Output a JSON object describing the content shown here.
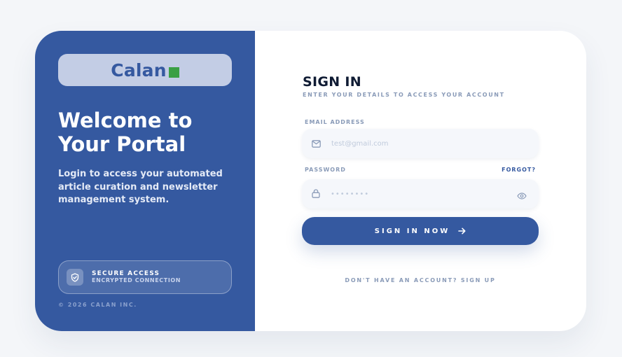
{
  "brand": {
    "name": "Calan",
    "accent_color": "#3aa045",
    "primary_color": "#3559a0"
  },
  "left_panel": {
    "welcome_line1": "Welcome to",
    "welcome_line2": "Your Portal",
    "description": "Login to access your automated article curation and newsletter management system.",
    "secure_title": "SECURE ACCESS",
    "secure_subtitle": "ENCRYPTED CONNECTION",
    "secure_icon": "shield-check-icon",
    "copyright": "© 2026 CALAN INC."
  },
  "form": {
    "title": "SIGN IN",
    "subtitle": "ENTER YOUR DETAILS TO ACCESS YOUR ACCOUNT",
    "email_label": "EMAIL ADDRESS",
    "email_placeholder": "test@gmail.com",
    "email_icon": "mail-icon",
    "password_label": "PASSWORD",
    "forgot_label": "FORGOT?",
    "password_value": "••••••••",
    "password_icon": "lock-icon",
    "eye_icon": "eye-icon",
    "submit_label": "SIGN IN NOW",
    "submit_icon": "arrow-right-icon",
    "signup_text": "DON'T HAVE AN ACCOUNT? SIGN UP"
  }
}
